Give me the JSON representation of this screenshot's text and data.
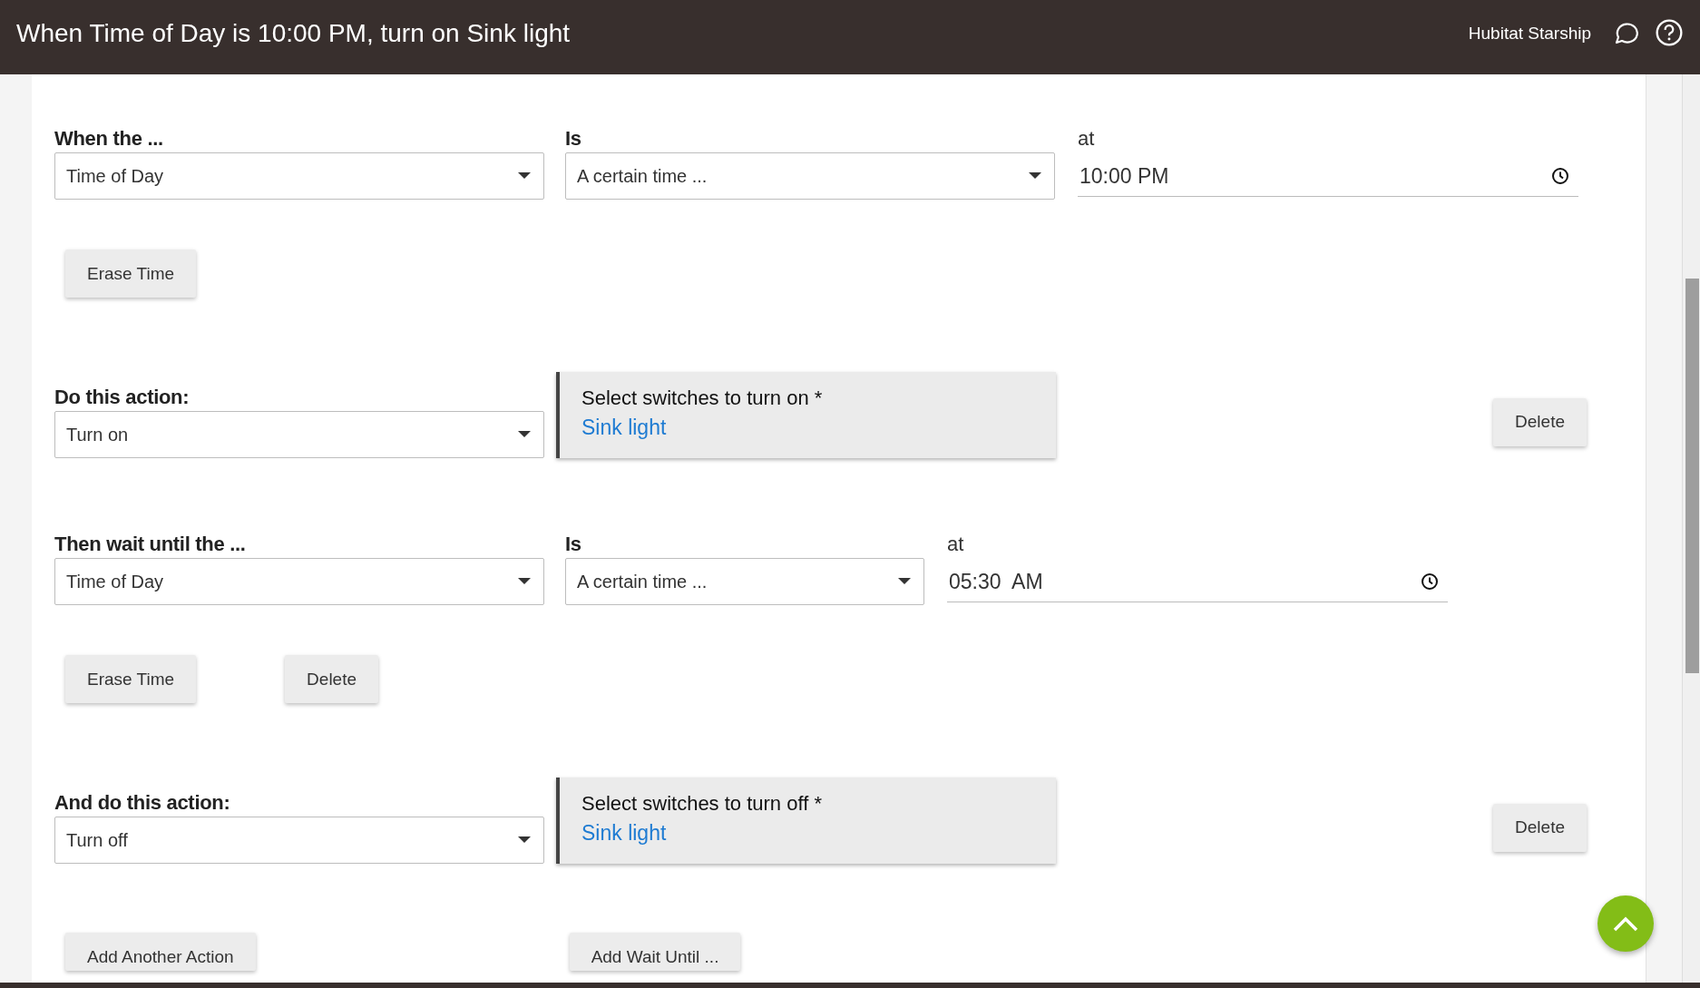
{
  "header": {
    "title": "When Time of Day is 10:00 PM, turn on Sink light",
    "hub_name": "Hubitat Starship"
  },
  "sections": [
    {
      "kind": "condition",
      "label": "When the ...",
      "select": "Time of Day",
      "is_label": "Is",
      "is_select": "A certain time ...",
      "at_label": "at",
      "time": "10:00 PM",
      "buttons": [
        "Erase Time"
      ]
    },
    {
      "kind": "action",
      "label": "Do this action:",
      "select": "Turn on",
      "switches_label": "Select switches to turn on *",
      "switches_value": "Sink light",
      "button": "Delete"
    },
    {
      "kind": "condition",
      "label": "Then wait until the ...",
      "select": "Time of Day",
      "is_label": "Is",
      "is_select": "A certain time ...",
      "at_label": "at",
      "time": "05:30  AM",
      "buttons": [
        "Erase Time",
        "Delete"
      ]
    },
    {
      "kind": "action",
      "label": "And do this action:",
      "select": "Turn off",
      "switches_label": "Select switches to turn off *",
      "switches_value": "Sink light",
      "button": "Delete"
    }
  ],
  "footer_buttons": [
    "Add Another Action",
    "Add Wait Until ..."
  ]
}
